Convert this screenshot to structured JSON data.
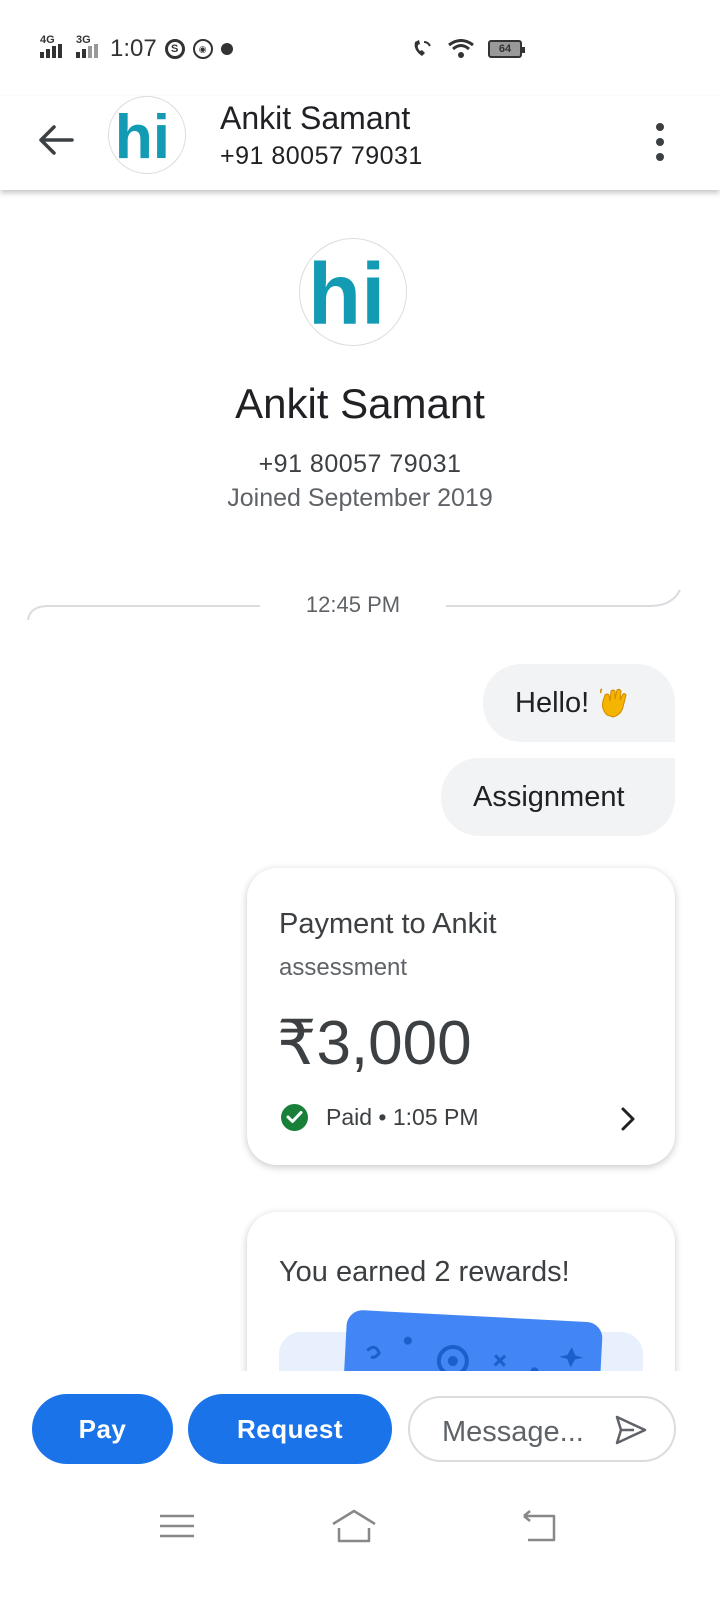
{
  "status_bar": {
    "network_1": "4G",
    "network_2": "3G",
    "time": "1:07",
    "battery_level": "64",
    "icons": [
      "signal-icon",
      "skype-icon",
      "app-notification-icon",
      "data-saver-icon",
      "wifi-calling-icon",
      "wifi-icon",
      "battery-icon"
    ]
  },
  "header": {
    "name": "Ankit Samant",
    "phone": "+91 80057 79031",
    "avatar_text": "hi",
    "back_icon": "arrow-back-icon",
    "menu_icon": "more-vert-icon"
  },
  "profile": {
    "name": "Ankit Samant",
    "phone": "+91 80057 79031",
    "joined": "Joined September 2019",
    "avatar_text": "hi"
  },
  "chat": {
    "divider_time": "12:45 PM",
    "messages": [
      {
        "text": "Hello!",
        "emoji": "waving-hand-emoji"
      },
      {
        "text": "Assignment"
      }
    ],
    "payment": {
      "title": "Payment to Ankit",
      "note": "assessment",
      "amount": "₹3,000",
      "status": "Paid • 1:05 PM",
      "status_icon": "check-circle-icon"
    },
    "reward": {
      "title": "You earned 2 rewards!"
    }
  },
  "actions": {
    "pay_label": "Pay",
    "request_label": "Request",
    "message_placeholder": "Message..."
  },
  "nav": {
    "items": [
      "menu-icon",
      "home-icon",
      "back-icon"
    ]
  },
  "colors": {
    "accent": "#1a73e8",
    "bubble": "#f1f3f4",
    "paid_green": "#188038",
    "avatar_teal": "#129bb3"
  }
}
